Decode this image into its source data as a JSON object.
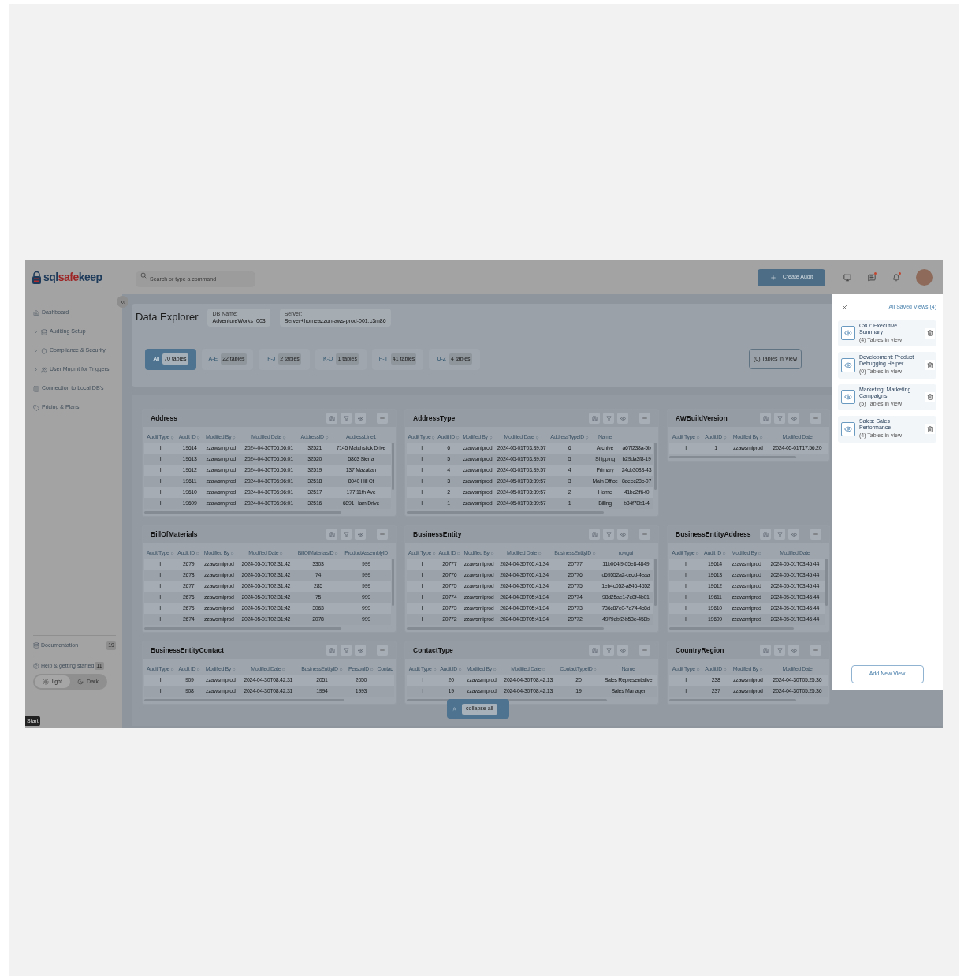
{
  "header": {
    "logo": {
      "prefix": "sql",
      "accent": "safe",
      "suffix": "keep"
    },
    "search": {
      "placeholder": "Search or type a command"
    },
    "create_button": "Create Audit",
    "icons": [
      {
        "kind": "monitor",
        "notify": false
      },
      {
        "kind": "messages",
        "notify": true
      },
      {
        "kind": "bell",
        "notify": true
      }
    ]
  },
  "sidebar": {
    "items": [
      {
        "label": "Dashboard",
        "kind": "home",
        "expandable": false
      },
      {
        "label": "Auditing Setup",
        "kind": "database",
        "expandable": true
      },
      {
        "label": "Compliance & Security",
        "kind": "shield",
        "expandable": true
      },
      {
        "label": "User Mngmt for Triggers",
        "kind": "users",
        "expandable": true
      },
      {
        "label": "Connection to Local DB's",
        "kind": "columns",
        "expandable": false
      },
      {
        "label": "Pricing & Plans",
        "kind": "tag",
        "expandable": false
      }
    ],
    "links": [
      {
        "label": "Documentation",
        "kind": "docs",
        "count": "19"
      },
      {
        "label": "Help & getting started",
        "kind": "help",
        "count": "11"
      }
    ],
    "theme": [
      {
        "label": "light",
        "kind": "sun",
        "selected": true
      },
      {
        "label": "Dark",
        "kind": "moon",
        "selected": false
      }
    ],
    "start_tag": "Start"
  },
  "explorer": {
    "title": "Data Explorer",
    "db": {
      "label": "DB Name:",
      "value": "AdventureWorks_003"
    },
    "server": {
      "label": "Server:",
      "value": "Server+homeazzon-aws-prod-001.c3m86"
    },
    "filters": [
      {
        "label": "All",
        "count": "70 tables",
        "selected": true
      },
      {
        "label": "A-E",
        "count": "22 tables",
        "selected": false
      },
      {
        "label": "F-J",
        "count": "2 tables",
        "selected": false
      },
      {
        "label": "K-O",
        "count": "1 tables",
        "selected": false
      },
      {
        "label": "P-T",
        "count": "41 tables",
        "selected": false
      },
      {
        "label": "U-Z",
        "count": "4 tables",
        "selected": false
      }
    ],
    "tables_in_view": "(0) Tables in View"
  },
  "tables": [
    {
      "title": "Address",
      "columns": [
        "Audit Type",
        "Audit ID",
        "Modified By",
        "Modified Date",
        "AddressID",
        "AddressLine1"
      ],
      "rows": [
        [
          "I",
          "19614",
          "zzawsmiprod",
          "2024-04-30T06:06:01",
          "32521",
          "7145 Matchstick Drive"
        ],
        [
          "I",
          "19613",
          "zzawsmiprod",
          "2024-04-30T06:06:01",
          "32520",
          "5863 Sierra"
        ],
        [
          "I",
          "19612",
          "zzawsmiprod",
          "2024-04-30T06:06:01",
          "32519",
          "137 Mazatlan"
        ],
        [
          "I",
          "19611",
          "zzawsmiprod",
          "2024-04-30T06:06:01",
          "32518",
          "8040 Hill Ct"
        ],
        [
          "I",
          "19610",
          "zzawsmiprod",
          "2024-04-30T06:06:01",
          "32517",
          "177 11th Ave"
        ],
        [
          "I",
          "19609",
          "zzawsmiprod",
          "2024-04-30T06:06:01",
          "32516",
          "6891 Ham Drive"
        ]
      ]
    },
    {
      "title": "AddressType",
      "columns": [
        "Audit Type",
        "Audit ID",
        "Modified By",
        "Modified Date",
        "AddressTypeID",
        "Name"
      ],
      "rows": [
        [
          "I",
          "6",
          "zzawsmiprod",
          "2024-05-01T03:39:57",
          "6",
          "Archive",
          "a67f238a-5b"
        ],
        [
          "I",
          "5",
          "zzawsmiprod",
          "2024-05-01T03:39:57",
          "5",
          "Shipping",
          "b29da3f8-19"
        ],
        [
          "I",
          "4",
          "zzawsmiprod",
          "2024-05-01T03:39:57",
          "4",
          "Primary",
          "24cb3088-43"
        ],
        [
          "I",
          "3",
          "zzawsmiprod",
          "2024-05-01T03:39:57",
          "3",
          "Main Office",
          "8eeec28c-07"
        ],
        [
          "I",
          "2",
          "zzawsmiprod",
          "2024-05-01T03:39:57",
          "2",
          "Home",
          "41bc2ff6-f0"
        ],
        [
          "I",
          "1",
          "zzawsmiprod",
          "2024-05-01T03:39:57",
          "1",
          "Billing",
          "b84f78b1-4"
        ]
      ]
    },
    {
      "title": "AWBuildVersion",
      "columns": [
        "Audit Type",
        "Audit ID",
        "Modified By",
        "Modified Date"
      ],
      "rows": [
        [
          "I",
          "1",
          "zzawsmiprod",
          "2024-05-01T17:56:20"
        ]
      ]
    },
    {
      "title": "BillOfMaterials",
      "columns": [
        "Audit Type",
        "Audit ID",
        "Modified By",
        "Modified Date",
        "BillOfMaterialsID",
        "ProductAssemblyID"
      ],
      "rows": [
        [
          "I",
          "2679",
          "zzawsmiprod",
          "2024-05-01T02:31:42",
          "3303",
          "999"
        ],
        [
          "I",
          "2678",
          "zzawsmiprod",
          "2024-05-01T02:31:42",
          "74",
          "999"
        ],
        [
          "I",
          "2677",
          "zzawsmiprod",
          "2024-05-01T02:31:42",
          "285",
          "999"
        ],
        [
          "I",
          "2676",
          "zzawsmiprod",
          "2024-05-01T02:31:42",
          "75",
          "999"
        ],
        [
          "I",
          "2675",
          "zzawsmiprod",
          "2024-05-01T02:31:42",
          "3063",
          "999"
        ],
        [
          "I",
          "2674",
          "zzawsmiprod",
          "2024-05-01T02:31:42",
          "2078",
          "999"
        ]
      ]
    },
    {
      "title": "BusinessEntity",
      "columns": [
        "Audit Type",
        "Audit ID",
        "Modified By",
        "Modified Date",
        "BusinessEntityID",
        "rowgui"
      ],
      "rows": [
        [
          "I",
          "20777",
          "zzawsmiprod",
          "2024-04-30T05:41:34",
          "20777",
          "11b064f9-05e8-4849"
        ],
        [
          "I",
          "20776",
          "zzawsmiprod",
          "2024-04-30T05:41:34",
          "20776",
          "d69552a2-cecd-4eaa"
        ],
        [
          "I",
          "20775",
          "zzawsmiprod",
          "2024-04-30T05:41:34",
          "20775",
          "1eb4c052-a846-4552"
        ],
        [
          "I",
          "20774",
          "zzawsmiprod",
          "2024-04-30T05:41:34",
          "20774",
          "98d25ae1-7e8f-4b01"
        ],
        [
          "I",
          "20773",
          "zzawsmiprod",
          "2024-04-30T05:41:34",
          "20773",
          "736c87e0-7a74-4c8d"
        ],
        [
          "I",
          "20772",
          "zzawsmiprod",
          "2024-04-30T05:41:34",
          "20772",
          "4979ebf2-b53e-458b"
        ]
      ]
    },
    {
      "title": "BusinessEntityAddress",
      "columns": [
        "Audit Type",
        "Audit ID",
        "Modified By",
        "Modified Date"
      ],
      "rows": [
        [
          "I",
          "19614",
          "zzawsmiprod",
          "2024-05-01T03:45:44"
        ],
        [
          "I",
          "19613",
          "zzawsmiprod",
          "2024-05-01T03:45:44"
        ],
        [
          "I",
          "19612",
          "zzawsmiprod",
          "2024-05-01T03:45:44"
        ],
        [
          "I",
          "19611",
          "zzawsmiprod",
          "2024-05-01T03:45:44"
        ],
        [
          "I",
          "19610",
          "zzawsmiprod",
          "2024-05-01T03:45:44"
        ],
        [
          "I",
          "19609",
          "zzawsmiprod",
          "2024-05-01T03:45:44"
        ]
      ]
    },
    {
      "title": "BusinessEntityContact",
      "columns": [
        "Audit Type",
        "Audit ID",
        "Modified By",
        "Modified Date",
        "BusinessEntityID",
        "PersonID",
        "Contac"
      ],
      "rows": [
        [
          "I",
          "909",
          "zzawsmiprod",
          "2024-04-30T08:42:31",
          "2051",
          "2050"
        ],
        [
          "I",
          "908",
          "zzawsmiprod",
          "2024-04-30T08:42:31",
          "1994",
          "1993"
        ]
      ]
    },
    {
      "title": "ContactType",
      "columns": [
        "Audit Type",
        "Audit ID",
        "Modified By",
        "Modified Date",
        "ContactTypeID",
        "Name"
      ],
      "rows": [
        [
          "I",
          "20",
          "zzawsmiprod",
          "2024-04-30T08:42:13",
          "20",
          "Sales Representative"
        ],
        [
          "I",
          "19",
          "zzawsmiprod",
          "2024-04-30T08:42:13",
          "19",
          "Sales Manager"
        ]
      ]
    },
    {
      "title": "CountryRegion",
      "columns": [
        "Audit Type",
        "Audit ID",
        "Modified By",
        "Modified Date"
      ],
      "rows": [
        [
          "I",
          "238",
          "zzawsmiprod",
          "2024-04-30T05:25:36"
        ],
        [
          "I",
          "237",
          "zzawsmiprod",
          "2024-04-30T05:25:36"
        ]
      ]
    }
  ],
  "collapse_button": "collapse all",
  "saved_views": {
    "title": "All Saved Views (4)",
    "views": [
      {
        "name": "CxO: Executive Summary",
        "count": "(4) Tables in view"
      },
      {
        "name": "Development: Product Debugging Helper",
        "count": "(0) Tables in view"
      },
      {
        "name": "Marketing: Marketing Campaigns",
        "count": "(5) Tables in view"
      },
      {
        "name": "Sales: Sales Performance",
        "count": "(4) Tables in view"
      }
    ],
    "add_button": "Add New View"
  }
}
